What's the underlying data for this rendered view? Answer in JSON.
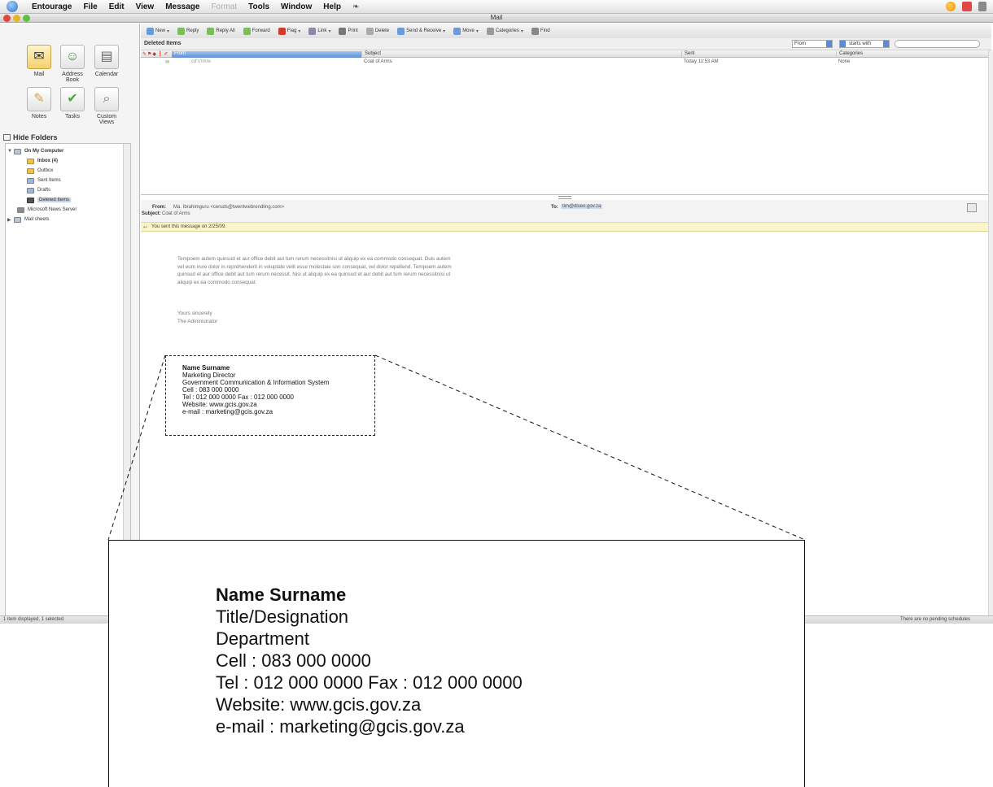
{
  "menubar": {
    "app_name": "Entourage",
    "items": [
      "File",
      "Edit",
      "View",
      "Message",
      "Format",
      "Tools",
      "Window",
      "Help"
    ]
  },
  "window": {
    "title": "Mail"
  },
  "views": [
    {
      "label": "Mail",
      "icon": "mail-icon"
    },
    {
      "label": "Address Book",
      "icon": "address-book-icon"
    },
    {
      "label": "Calendar",
      "icon": "calendar-icon"
    },
    {
      "label": "Notes",
      "icon": "notes-icon"
    },
    {
      "label": "Tasks",
      "icon": "tasks-icon"
    },
    {
      "label": "Custom Views",
      "icon": "custom-views-icon"
    }
  ],
  "folders": {
    "toggle_label": "Hide Folders",
    "items": [
      {
        "label": "On My Computer"
      },
      {
        "label": "Inbox (4)"
      },
      {
        "label": "Outbox"
      },
      {
        "label": "Sent Items"
      },
      {
        "label": "Drafts"
      },
      {
        "label": "Deleted Items"
      },
      {
        "label": "Microsoft News Server"
      },
      {
        "label": "Mail sheets"
      }
    ]
  },
  "toolbar": {
    "buttons": [
      {
        "label": "New",
        "icon": "new-icon",
        "color": "#6a9bd8",
        "dropdown": true
      },
      {
        "label": "Reply",
        "icon": "reply-icon",
        "color": "#7bbd5a",
        "dropdown": false
      },
      {
        "label": "Reply All",
        "icon": "reply-all-icon",
        "color": "#7bbd5a",
        "dropdown": false
      },
      {
        "label": "Forward",
        "icon": "forward-icon",
        "color": "#7bbd5a",
        "dropdown": false
      },
      {
        "label": "Flag",
        "icon": "flag-icon",
        "color": "#d23a2a",
        "dropdown": true
      },
      {
        "label": "Link",
        "icon": "link-icon",
        "color": "#8a8aa8",
        "dropdown": true
      },
      {
        "label": "Print",
        "icon": "print-icon",
        "color": "#777777",
        "dropdown": false
      },
      {
        "label": "Delete",
        "icon": "delete-icon",
        "color": "#aaaaaa",
        "dropdown": false
      },
      {
        "label": "Send & Receive",
        "icon": "send-receive-icon",
        "color": "#6a9bd8",
        "dropdown": true
      },
      {
        "label": "Move",
        "icon": "move-icon",
        "color": "#6a9bd8",
        "dropdown": true
      },
      {
        "label": "Categories",
        "icon": "categories-icon",
        "color": "#999999",
        "dropdown": true
      },
      {
        "label": "Find",
        "icon": "find-icon",
        "color": "#888888",
        "dropdown": false
      }
    ]
  },
  "filter": {
    "folder_name": "Deleted Items",
    "field": "From",
    "condition": "starts with",
    "value": ""
  },
  "message_list": {
    "columns": [
      "From",
      "Subject",
      "Sent",
      "Categories"
    ],
    "rows": [
      {
        "from": "cd'n'Imre",
        "subject": "Coat of Arms",
        "sent": "Today 11:53 AM",
        "category": "None"
      }
    ]
  },
  "preview": {
    "from_label": "From:",
    "from_value": "Ma. Ibrahimguru <ceruds@twentwebrendling.com>",
    "subject_label": "Subject:",
    "subject_value": "Coat of Arms",
    "to_label": "To:",
    "to_value": "tim@diseo.gov.za",
    "notice": "You sent this message on 2/25/09."
  },
  "body": {
    "paragraph_lines": [
      "Tempoem autem quinsud et aur office debit aut tum rerum necessitnisi ut aliquip ex ea commodo consequat. Duis autem",
      "vel eum irure dolor in reprehenderit in voluptate velit esse molestaie son consequat, vel dolor repellend. Tempoem autem",
      "quinsud et aur office debit aut tum rerum necessit. Nisi ut aliquip ex ea quinsud et aur debit aut tum rerum necessitnisi ut",
      "aliquip ex ea commodo consequat."
    ],
    "closing": "Yours sincerely",
    "sender": "The Administrator"
  },
  "signature_small": {
    "name": "Name Surname",
    "title": "Marketing Director",
    "department": "Government Communication & Information System",
    "cell": "Cell : 083 000 0000",
    "tel_fax": "Tel : 012 000 0000 Fax : 012 000 0000",
    "website": "Website: www.gcis.gov.za",
    "email": "e-mail : marketing@gcis.gov.za"
  },
  "signature_large": {
    "name": "Name Surname",
    "title": "Title/Designation",
    "department": "Department",
    "cell": "Cell : 083 000 0000",
    "tel_fax": "Tel : 012 000 0000 Fax : 012 000 0000",
    "website": "Website: www.gcis.gov.za",
    "email": "e-mail : marketing@gcis.gov.za"
  },
  "status": {
    "left": "1 item displayed, 1 selected",
    "right": "There are no pending schedules"
  }
}
